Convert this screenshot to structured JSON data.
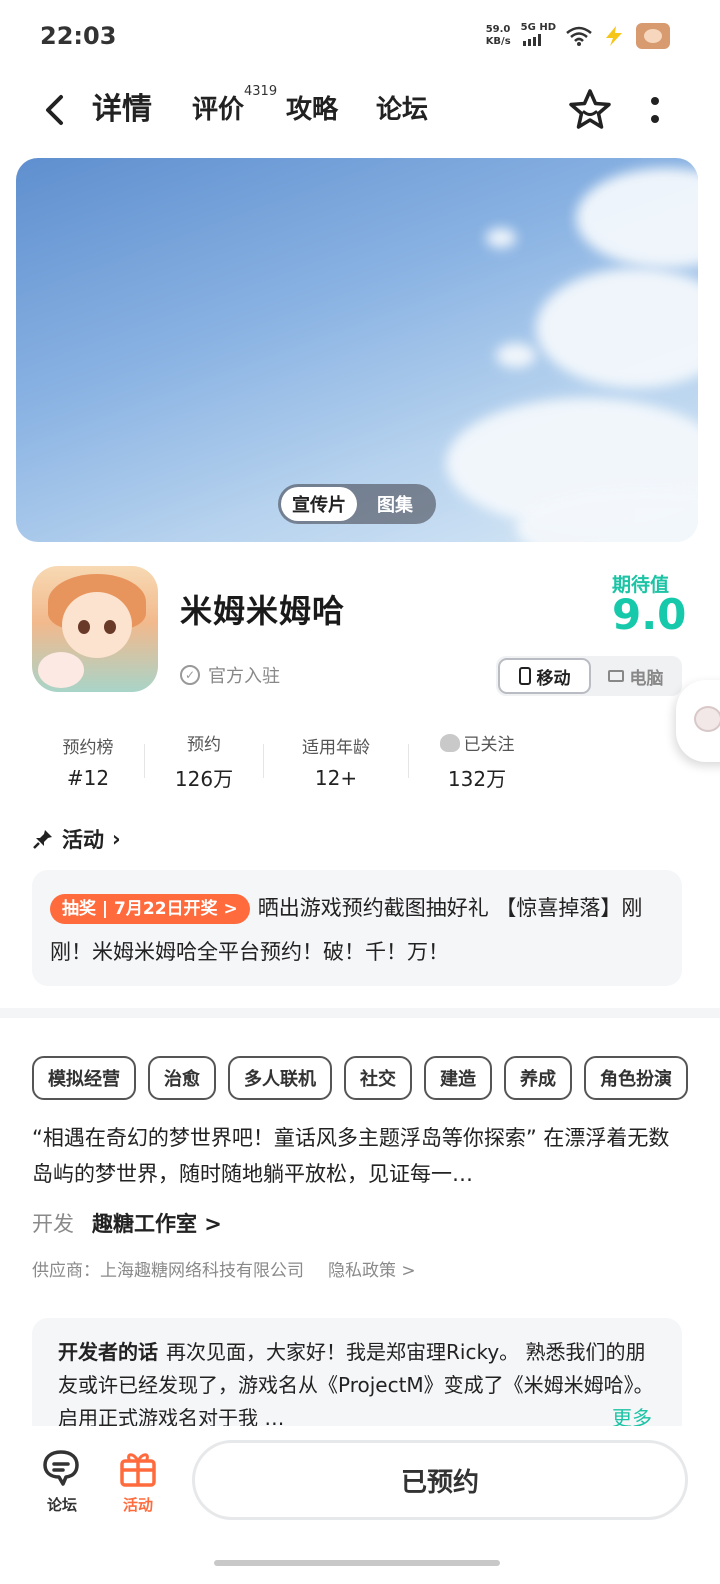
{
  "status_bar": {
    "time": "22:03",
    "net_speed_value": "59.0",
    "net_speed_unit": "KB/s",
    "network": "5G HD"
  },
  "nav": {
    "tabs": [
      {
        "label": "详情",
        "active": true
      },
      {
        "label": "评价"
      },
      {
        "label": "攻略"
      },
      {
        "label": "论坛"
      }
    ],
    "review_count": "4319"
  },
  "hero": {
    "media_options": [
      "宣传片",
      "图集"
    ],
    "selected": "宣传片"
  },
  "game": {
    "title": "米姆米姆哈",
    "official_label": "官方入驻",
    "expect_label": "期待值",
    "expect_value": "9.0",
    "platforms": [
      "移动",
      "电脑"
    ],
    "selected_platform": "移动"
  },
  "stats": [
    {
      "label": "预约榜",
      "value": "#12"
    },
    {
      "label": "预约",
      "value": "126万"
    },
    {
      "label": "适用年龄",
      "value": "12+"
    },
    {
      "label": "已关注",
      "value": "132万"
    }
  ],
  "activity": {
    "heading": "活动",
    "tag": "抽奖 | 7月22日开奖 >",
    "text": "晒出游戏预约截图抽好礼 【惊喜掉落】刚刚！米姆米姆哈全平台预约！破！千！万！"
  },
  "tags": [
    "模拟经营",
    "治愈",
    "多人联机",
    "社交",
    "建造",
    "养成",
    "角色扮演"
  ],
  "description": "“相遇在奇幻的梦世界吧！童话风多主题浮岛等你探索” 在漂浮着无数岛屿的梦世界，随时随地躺平放松，见证每一…",
  "developer": {
    "label": "开发",
    "name": "趣糖工作室 >"
  },
  "supplier": {
    "text": "供应商：上海趣糖网络科技有限公司",
    "privacy": "隐私政策 >"
  },
  "dev_words": {
    "title": "开发者的话",
    "text": "再次见面，大家好！我是郑宙理Ricky。 熟悉我们的朋友或许已经发现了，游戏名从《ProjectM》变成了《米姆米姆哈》。启用正式游戏名对于我 …",
    "more": "更多"
  },
  "bottom": {
    "forum_label": "论坛",
    "activity_label": "活动",
    "reserve_label": "已预约"
  },
  "colors": {
    "accent": "#1cc3a5",
    "activity_tag": "#ff6b3d",
    "active_bottom": "#ff6b3d"
  }
}
